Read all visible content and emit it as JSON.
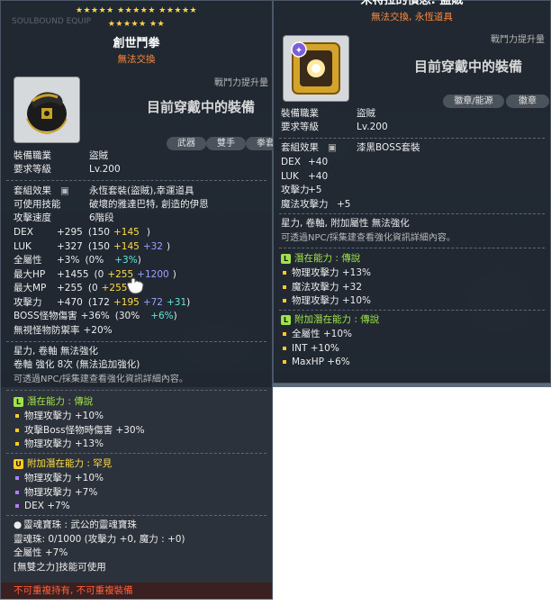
{
  "left": {
    "stars_row1": "★★★★★ ★★★★★ ★★★★★",
    "stars_row2": "★★★★★ ★★",
    "watermark": "SOULBOUND EQUIP",
    "name": "創世鬥拳",
    "tradability": "無法交換",
    "power_label": "戰鬥力提升量",
    "equipped_text": "目前穿戴中的裝備",
    "tabs": [
      "武器",
      "雙手",
      "拳套"
    ],
    "job_label": "裝備職業",
    "job_value": "盜賊",
    "level_label": "要求等級",
    "level_value": "Lv.200",
    "set_label": "套組效果",
    "set_value": "永恆套裝(盜賊),幸運道具",
    "skill_label": "可使用技能",
    "skill_value": "破壞的雅達巴特, 創造的伊恩",
    "speed_label": "攻擊速度",
    "speed_value": "6階段",
    "stats": [
      {
        "name": "DEX",
        "total": "+295",
        "open": "(150",
        "p1": "+145",
        "p2": "",
        "p3": "",
        "close": ")"
      },
      {
        "name": "LUK",
        "total": "+327",
        "open": "(150",
        "p1": "+145",
        "p2": "+32",
        "p3": "",
        "close": ")"
      },
      {
        "name": "全屬性",
        "total": "+3%",
        "open": "(0%",
        "p1": "",
        "p2": "",
        "p3": "+3%",
        "close": ")"
      },
      {
        "name": "最大HP",
        "total": "+1455",
        "open": "(0",
        "p1": "+255",
        "p2": "+1200",
        "p3": "",
        "close": ")"
      },
      {
        "name": "最大MP",
        "total": "+255",
        "open": "(0",
        "p1": "+255",
        "p2": "",
        "p3": "",
        "close": ")"
      },
      {
        "name": "攻擊力",
        "total": "+470",
        "open": "(172",
        "p1": "+195",
        "p2": "+72",
        "p3": "+31",
        "close": ")"
      },
      {
        "name": "BOSS怪物傷害",
        "total": "+36%",
        "open": "(30%",
        "p1": "",
        "p2": "",
        "p3": "+6%",
        "close": ")"
      },
      {
        "name": "無視怪物防禦率",
        "total": "+20%",
        "open": "",
        "p1": "",
        "p2": "",
        "p3": "",
        "close": ""
      }
    ],
    "star_force": "星力, 卷軸 無法強化",
    "scroll": "卷軸 強化 8次 (無法追加強化)",
    "npc_hint": "可透過NPC/採集建查看強化資訊詳細內容。",
    "potential_title": "潛在能力 : 傳說",
    "potential": [
      "物理攻擊力 +10%",
      "攻擊Boss怪物時傷害 +30%",
      "物理攻擊力 +13%"
    ],
    "bonus_title": "附加潛在能力 : 罕見",
    "bonus": [
      "物理攻擊力 +10%",
      "物理攻擊力 +7%",
      "DEX +7%"
    ],
    "soul_title": "靈魂寶珠 : 武公的靈魂寶珠",
    "soul_line": "靈魂珠: 0/1000 (攻擊力 +0, 魔力 : +0)",
    "soul_stat": "全屬性 +7%",
    "soul_skill": "[無雙之力]技能可使用",
    "footer": "不可重複持有, 不可重複裝備"
  },
  "right": {
    "name": "米特拉的憤怒: 盜賊",
    "tradability": "無法交換, 永恆道具",
    "power_label": "戰鬥力提升量",
    "equipped_text": "目前穿戴中的裝備",
    "tabs": [
      "徽章/能源",
      "徽章"
    ],
    "job_label": "裝備職業",
    "job_value": "盜賊",
    "level_label": "要求等級",
    "level_value": "Lv.200",
    "set_label": "套組效果",
    "set_value": "漆黑BOSS套裝",
    "stats": [
      {
        "name": "DEX",
        "value": "+40"
      },
      {
        "name": "LUK",
        "value": "+40"
      },
      {
        "name": "攻擊力",
        "value": "+5"
      },
      {
        "name": "魔法攻擊力",
        "value": "+5"
      }
    ],
    "star_force": "星力, 卷軸, 附加屬性 無法強化",
    "npc_hint": "可透過NPC/採集建查看強化資訊詳細內容。",
    "potential_title": "潛在能力 : 傳說",
    "potential": [
      "物理攻擊力 +13%",
      "魔法攻擊力 +32",
      "物理攻擊力 +10%"
    ],
    "bonus_title": "附加潛在能力 : 傳說",
    "bonus": [
      "全屬性 +10%",
      "INT +10%",
      "MaxHP +6%"
    ]
  }
}
